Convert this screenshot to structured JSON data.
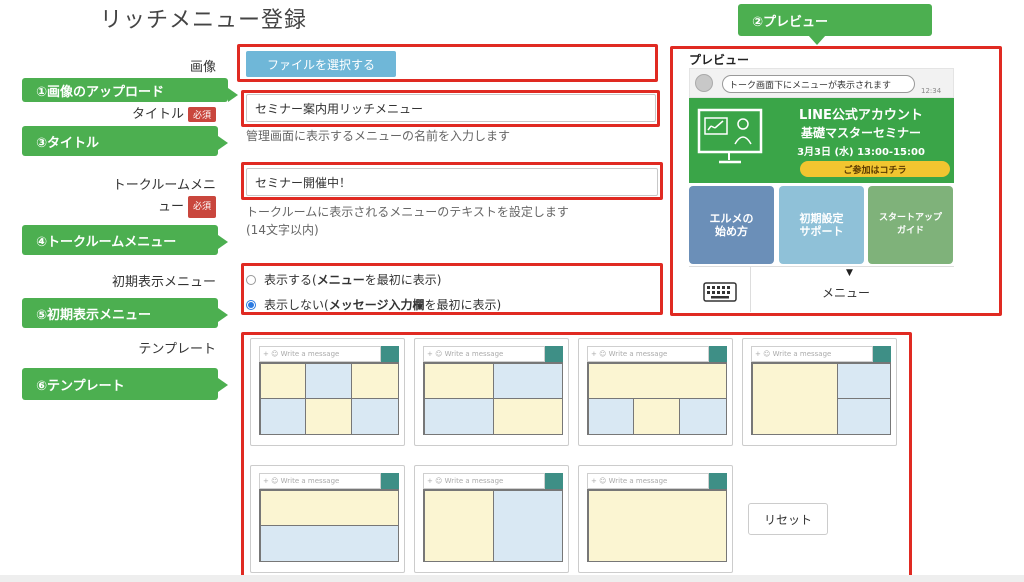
{
  "page": {
    "title": "リッチメニュー登録"
  },
  "form": {
    "image_label": "画像",
    "file_button": "ファイルを選択する",
    "title_label": "タイトル",
    "required_badge": "必須",
    "title_value": "セミナー案内用リッチメニュー",
    "title_help": "管理画面に表示するメニューの名前を入力します",
    "chatbar_label_line1": "トークルームメニ",
    "chatbar_label_line2": "ュー",
    "chatbar_value": "セミナー開催中！",
    "chatbar_help_line1": "トークルームに表示されるメニューのテキストを設定します",
    "chatbar_help_line2": "(14文字以内)",
    "initial_label": "初期表示メニュー",
    "initial_options": [
      {
        "prefix": "表示する(",
        "bold": "メニュー",
        "suffix": "を最初に表示)",
        "selected": false
      },
      {
        "prefix": "表示しない(",
        "bold": "メッセージ入力欄",
        "suffix": "を最初に表示)",
        "selected": true
      }
    ],
    "template_label": "テンプレート",
    "template_placeholder": "Write a message",
    "reset_button": "リセット"
  },
  "callouts": {
    "preview": "②プレビュー",
    "upload": "①画像のアップロード",
    "title": "③タイトル",
    "chatbar": "④トークルームメニュー",
    "initial": "⑤初期表示メニュー",
    "template": "⑥テンプレート"
  },
  "preview": {
    "heading": "プレビュー",
    "bubble_text": "トーク画面下にメニューが表示されます",
    "time": "12:34",
    "banner_title": "LINE公式アカウント",
    "banner_subtitle": "基礎マスターセミナー",
    "banner_date": "3月3日 (水) 13:00-15:00",
    "banner_cta": "ご参加はコチラ",
    "tiles": [
      {
        "line1": "エルメの",
        "line2": "始め方",
        "color": "#6b8fb8"
      },
      {
        "line1": "初期設定",
        "line2": "サポート",
        "color": "#8fc1d8"
      },
      {
        "line1": "スタートアップ",
        "line2": "ガイド",
        "color": "#7fb27a"
      }
    ],
    "menu_label": "メニュー",
    "arrow": "▼"
  },
  "colors": {
    "highlight_red": "#e02a22",
    "callout_green": "#4caf50",
    "file_button_blue": "#6fb7d8",
    "banner_green": "#3aa548",
    "template_yellow": "#fbf5d2",
    "template_blue": "#d9e8f3",
    "template_teal": "#3e8f86"
  },
  "icons": [
    "plus-icon",
    "smiley-icon",
    "keyboard-icon",
    "chevron-down-icon"
  ]
}
